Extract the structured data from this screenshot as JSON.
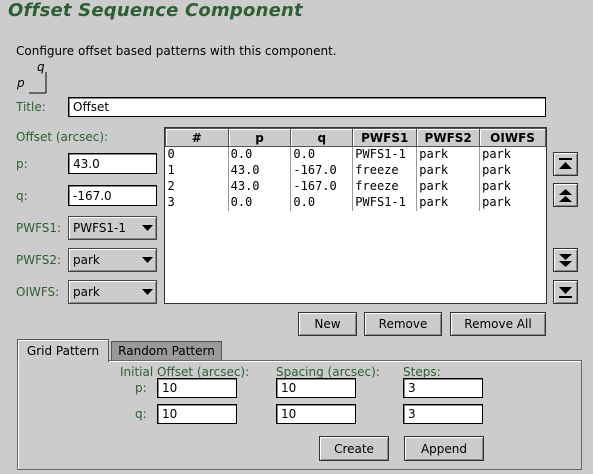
{
  "header": {
    "title": "Offset Sequence Component"
  },
  "description": "Configure offset based patterns with this component.",
  "axes": {
    "p": "p",
    "q": "q"
  },
  "form": {
    "title_label": "Title:",
    "title_value": "Offset",
    "offset_label": "Offset (arcsec):",
    "p_label": "p:",
    "p_value": "43.0",
    "q_label": "q:",
    "q_value": "-167.0",
    "pwfs1_label": "PWFS1:",
    "pwfs1_value": "PWFS1-1",
    "pwfs2_label": "PWFS2:",
    "pwfs2_value": "park",
    "oiwfs_label": "OIWFS:",
    "oiwfs_value": "park"
  },
  "table": {
    "columns": [
      "#",
      "p",
      "q",
      "PWFS1",
      "PWFS2",
      "OIWFS"
    ],
    "rows": [
      [
        "0",
        "0.0",
        "0.0",
        "PWFS1-1",
        "park",
        "park"
      ],
      [
        "1",
        "43.0",
        "-167.0",
        "freeze",
        "park",
        "park"
      ],
      [
        "2",
        "43.0",
        "-167.0",
        "freeze",
        "park",
        "park"
      ],
      [
        "3",
        "0.0",
        "0.0",
        "PWFS1-1",
        "park",
        "park"
      ]
    ]
  },
  "buttons": {
    "new": "New",
    "remove": "Remove",
    "remove_all": "Remove All",
    "create": "Create",
    "append": "Append"
  },
  "tabs": {
    "grid": "Grid Pattern",
    "random": "Random Pattern"
  },
  "grid": {
    "initial_offset_label": "Initial Offset (arcsec):",
    "spacing_label": "Spacing (arcsec):",
    "steps_label": "Steps:",
    "p_label": "p:",
    "q_label": "q:",
    "initial_p": "10",
    "initial_q": "10",
    "spacing_p": "10",
    "spacing_q": "10",
    "steps_p": "3",
    "steps_q": "3"
  },
  "icons": {
    "move_top": "move-to-top-icon",
    "move_up": "move-up-icon",
    "move_down": "move-down-icon",
    "move_bottom": "move-to-bottom-icon",
    "dropdown": "chevron-down-icon"
  },
  "colors": {
    "background": "#cccccc",
    "label_green": "#2e5e34",
    "accent_green": "#3b6b3b"
  }
}
